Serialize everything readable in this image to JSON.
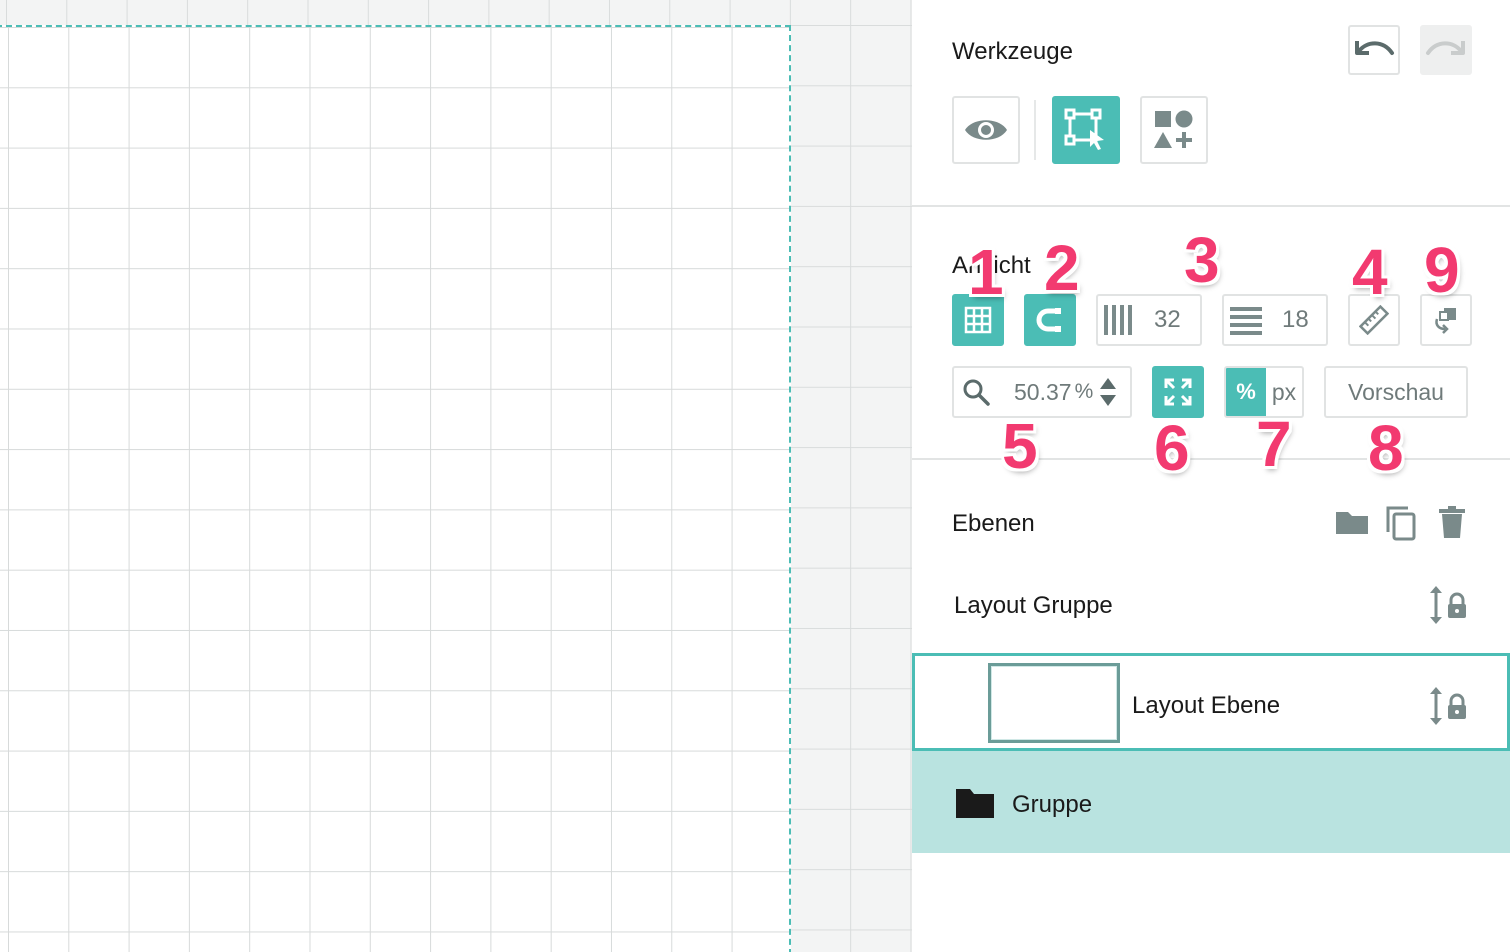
{
  "tools": {
    "title": "Werkzeuge",
    "icons": [
      "undo-icon",
      "redo-icon",
      "eye-icon",
      "transform-select-icon",
      "add-shapes-icon"
    ]
  },
  "view": {
    "title": "Ansicht",
    "columns_value": "32",
    "rows_value": "18",
    "zoom_value": "50.37",
    "zoom_unit": "%",
    "unit_percent": "%",
    "unit_px": "px",
    "preview_label": "Vorschau"
  },
  "markers": [
    "1",
    "2",
    "3",
    "4",
    "9",
    "5",
    "6",
    "7",
    "8"
  ],
  "layers": {
    "title": "Ebenen",
    "items": [
      {
        "label": "Layout Gruppe"
      },
      {
        "label": "Layout Ebene"
      },
      {
        "label": "Gruppe"
      }
    ]
  },
  "colors": {
    "accent": "#4bbdb5",
    "selected_row": "#b9e3e0",
    "marker": "#f23a70"
  }
}
